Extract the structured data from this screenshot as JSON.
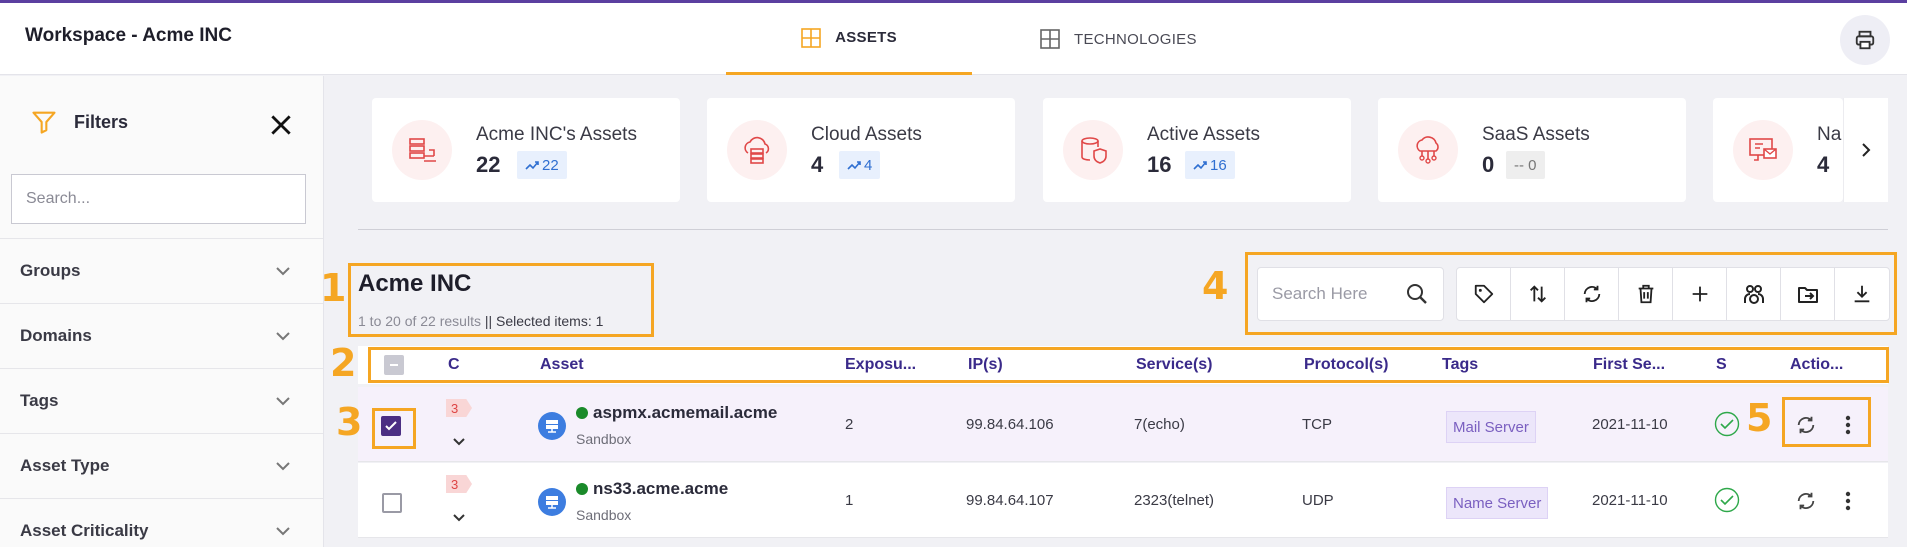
{
  "header": {
    "workspace_title": "Workspace - Acme INC",
    "tabs": [
      {
        "label": "ASSETS",
        "active": true
      },
      {
        "label": "TECHNOLOGIES",
        "active": false
      }
    ],
    "print_icon": "printer-icon"
  },
  "sidebar": {
    "title": "Filters",
    "search_placeholder": "Search...",
    "filters": [
      "Groups",
      "Domains",
      "Tags",
      "Asset Type",
      "Asset Criticality"
    ]
  },
  "summary_cards": [
    {
      "title": "Acme INC's Assets",
      "value": "22",
      "trend": "22",
      "icon": "server-network-icon"
    },
    {
      "title": "Cloud Assets",
      "value": "4",
      "trend": "4",
      "icon": "cloud-server-icon"
    },
    {
      "title": "Active Assets",
      "value": "16",
      "trend": "16",
      "icon": "database-shield-icon"
    },
    {
      "title": "SaaS Assets",
      "value": "0",
      "trend": "-- 0",
      "icon": "cloud-network-icon"
    },
    {
      "title": "Na",
      "value": "4",
      "trend": "",
      "icon": "monitor-mail-icon"
    }
  ],
  "table": {
    "title": "Acme INC",
    "range_text": "1 to 20 of 22 results",
    "selected_text": "|| Selected items: 1",
    "search_placeholder": "Search Here",
    "columns": [
      "C",
      "Asset",
      "Exposu...",
      "IP(s)",
      "Service(s)",
      "Protocol(s)",
      "Tags",
      "First Se...",
      "S",
      "Actio..."
    ],
    "rows": [
      {
        "selected": true,
        "criticality": "3",
        "asset": "aspmx.acmemail.acme",
        "group": "Sandbox",
        "exposure": "2",
        "ip": "99.84.64.106",
        "service": "7(echo)",
        "protocol": "TCP",
        "tag": "Mail Server",
        "first_seen": "2021-11-10"
      },
      {
        "selected": false,
        "criticality": "3",
        "asset": "ns33.acme.acme",
        "group": "Sandbox",
        "exposure": "1",
        "ip": "99.84.64.107",
        "service": "2323(telnet)",
        "protocol": "UDP",
        "tag": "Name Server",
        "first_seen": "2021-11-10"
      }
    ]
  },
  "annotations": [
    "1",
    "2",
    "3",
    "4",
    "5"
  ],
  "colors": {
    "accent": "#f5a623",
    "primary": "#4b2e83",
    "header_text": "#3a2a8a",
    "status_ok": "#2ea84a"
  }
}
